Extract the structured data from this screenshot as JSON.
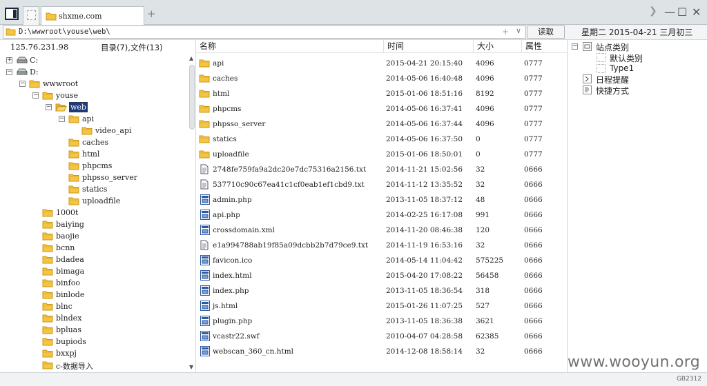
{
  "tabs": [
    {
      "label": "shxme.com",
      "active": true
    }
  ],
  "window": {
    "minimize": "—",
    "maximize": "☐",
    "close": "✕",
    "forward": "❯",
    "new_tab": "+"
  },
  "address": {
    "path": "D:\\wwwroot\\youse\\web\\",
    "plus": "+",
    "dropdown": "∨",
    "read_button": "读取"
  },
  "date_label": "星期二 2015-04-21 三月初三",
  "left": {
    "ip": "125.76.231.98",
    "count": "目录(7),文件(13)",
    "tree": [
      {
        "label": "C:",
        "depth": 0,
        "exp": "+",
        "icon": "drive"
      },
      {
        "label": "D:",
        "depth": 0,
        "exp": "−",
        "icon": "drive"
      },
      {
        "label": "wwwroot",
        "depth": 1,
        "exp": "−",
        "icon": "folder"
      },
      {
        "label": "youse",
        "depth": 2,
        "exp": "−",
        "icon": "folder"
      },
      {
        "label": "web",
        "depth": 3,
        "exp": "−",
        "icon": "folder-open",
        "selected": true
      },
      {
        "label": "api",
        "depth": 4,
        "exp": "−",
        "icon": "folder"
      },
      {
        "label": "video_api",
        "depth": 5,
        "exp": "",
        "icon": "folder"
      },
      {
        "label": "caches",
        "depth": 4,
        "exp": "",
        "icon": "folder"
      },
      {
        "label": "html",
        "depth": 4,
        "exp": "",
        "icon": "folder"
      },
      {
        "label": "phpcms",
        "depth": 4,
        "exp": "",
        "icon": "folder"
      },
      {
        "label": "phpsso_server",
        "depth": 4,
        "exp": "",
        "icon": "folder"
      },
      {
        "label": "statics",
        "depth": 4,
        "exp": "",
        "icon": "folder"
      },
      {
        "label": "uploadfile",
        "depth": 4,
        "exp": "",
        "icon": "folder"
      },
      {
        "label": "1000t",
        "depth": 2,
        "exp": "",
        "icon": "folder"
      },
      {
        "label": "baiying",
        "depth": 2,
        "exp": "",
        "icon": "folder"
      },
      {
        "label": "baojie",
        "depth": 2,
        "exp": "",
        "icon": "folder"
      },
      {
        "label": "bcnn",
        "depth": 2,
        "exp": "",
        "icon": "folder"
      },
      {
        "label": "bdadea",
        "depth": 2,
        "exp": "",
        "icon": "folder"
      },
      {
        "label": "bimaga",
        "depth": 2,
        "exp": "",
        "icon": "folder"
      },
      {
        "label": "binfoo",
        "depth": 2,
        "exp": "",
        "icon": "folder"
      },
      {
        "label": "binlode",
        "depth": 2,
        "exp": "",
        "icon": "folder"
      },
      {
        "label": "blnc",
        "depth": 2,
        "exp": "",
        "icon": "folder"
      },
      {
        "label": "blndex",
        "depth": 2,
        "exp": "",
        "icon": "folder"
      },
      {
        "label": "bpluas",
        "depth": 2,
        "exp": "",
        "icon": "folder"
      },
      {
        "label": "bupiods",
        "depth": 2,
        "exp": "",
        "icon": "folder"
      },
      {
        "label": "bxxpj",
        "depth": 2,
        "exp": "",
        "icon": "folder"
      },
      {
        "label": "c-数据导入",
        "depth": 2,
        "exp": "",
        "icon": "folder"
      }
    ],
    "scroll_up": "▲",
    "scroll_down": "▼"
  },
  "files": {
    "columns": {
      "name": "名称",
      "time": "时间",
      "size": "大小",
      "attr": "属性"
    },
    "rows": [
      {
        "name": "api",
        "time": "2015-04-21 20:15:40",
        "size": "4096",
        "attr": "0777",
        "icon": "folder"
      },
      {
        "name": "caches",
        "time": "2014-05-06 16:40:48",
        "size": "4096",
        "attr": "0777",
        "icon": "folder"
      },
      {
        "name": "html",
        "time": "2015-01-06 18:51:16",
        "size": "8192",
        "attr": "0777",
        "icon": "folder"
      },
      {
        "name": "phpcms",
        "time": "2014-05-06 16:37:41",
        "size": "4096",
        "attr": "0777",
        "icon": "folder"
      },
      {
        "name": "phpsso_server",
        "time": "2014-05-06 16:37:44",
        "size": "4096",
        "attr": "0777",
        "icon": "folder"
      },
      {
        "name": "statics",
        "time": "2014-05-06 16:37:50",
        "size": "0",
        "attr": "0777",
        "icon": "folder"
      },
      {
        "name": "uploadfile",
        "time": "2015-01-06 18:50:01",
        "size": "0",
        "attr": "0777",
        "icon": "folder"
      },
      {
        "name": "2748fe759fa9a2dc20e7dc75316a2156.txt",
        "time": "2014-11-21 15:02:56",
        "size": "32",
        "attr": "0666",
        "icon": "txt"
      },
      {
        "name": "537710c90c67ea41c1cf0eab1ef1cbd9.txt",
        "time": "2014-11-12 13:35:52",
        "size": "32",
        "attr": "0666",
        "icon": "txt"
      },
      {
        "name": "admin.php",
        "time": "2013-11-05 18:37:12",
        "size": "48",
        "attr": "0666",
        "icon": "file"
      },
      {
        "name": "api.php",
        "time": "2014-02-25 16:17:08",
        "size": "991",
        "attr": "0666",
        "icon": "file"
      },
      {
        "name": "crossdomain.xml",
        "time": "2014-11-20 08:46:38",
        "size": "120",
        "attr": "0666",
        "icon": "file"
      },
      {
        "name": "e1a994788ab19f85a09dcbb2b7d79ce9.txt",
        "time": "2014-11-19 16:53:16",
        "size": "32",
        "attr": "0666",
        "icon": "txt"
      },
      {
        "name": "favicon.ico",
        "time": "2014-05-14 11:04:42",
        "size": "575225",
        "attr": "0666",
        "icon": "file"
      },
      {
        "name": "index.html",
        "time": "2015-04-20 17:08:22",
        "size": "56458",
        "attr": "0666",
        "icon": "file"
      },
      {
        "name": "index.php",
        "time": "2013-11-05 18:36:54",
        "size": "318",
        "attr": "0666",
        "icon": "file"
      },
      {
        "name": "js.html",
        "time": "2015-01-26 11:07:25",
        "size": "527",
        "attr": "0666",
        "icon": "file"
      },
      {
        "name": "plugin.php",
        "time": "2013-11-05 18:36:38",
        "size": "3621",
        "attr": "0666",
        "icon": "file"
      },
      {
        "name": "vcastr22.swf",
        "time": "2010-04-07 04:28:58",
        "size": "62385",
        "attr": "0666",
        "icon": "file"
      },
      {
        "name": "webscan_360_cn.html",
        "time": "2014-12-08 18:58:14",
        "size": "32",
        "attr": "0666",
        "icon": "file"
      }
    ]
  },
  "right": {
    "items": [
      {
        "label": "站点类别",
        "depth": 0,
        "exp": "−",
        "icon": "box"
      },
      {
        "label": "默认类别",
        "depth": 1,
        "exp": "",
        "icon": "dotted"
      },
      {
        "label": "Type1",
        "depth": 1,
        "exp": "",
        "icon": "dotted"
      },
      {
        "label": "日程提醒",
        "depth": 0,
        "exp": "",
        "icon": "clock"
      },
      {
        "label": "快捷方式",
        "depth": 0,
        "exp": "",
        "icon": "doc"
      }
    ]
  },
  "status": {
    "encoding": "GB2312",
    "watermark": "www.wooyun.org"
  },
  "colors": {
    "folder": "#f5c542",
    "folder_border": "#c9961a",
    "selection": "#1d3b7c",
    "file_icon": "#2c5aa0"
  }
}
